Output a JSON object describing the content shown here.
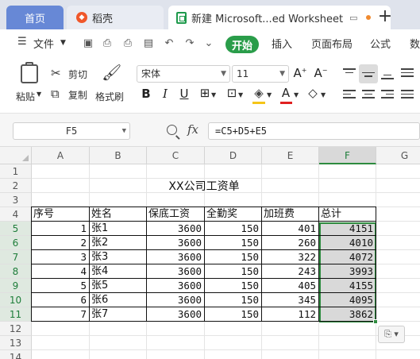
{
  "tabs": {
    "home": "首页",
    "docer": "稻壳",
    "workbook": "新建 Microsoft...ed Worksheet",
    "add": "+"
  },
  "menu": {
    "file": "文件",
    "start": "开始",
    "insert": "插入",
    "layout": "页面布局",
    "formula": "公式",
    "data": "数"
  },
  "ribbon": {
    "paste": "粘贴",
    "cut": "剪切",
    "copy": "复制",
    "format_painter": "格式刷",
    "font_name": "宋体",
    "font_size": "11",
    "bold": "B",
    "italic": "I",
    "underline": "U"
  },
  "formula_bar": {
    "cell_ref": "F5",
    "fx": "fx",
    "formula": "=C5+D5+E5"
  },
  "sheet": {
    "columns": [
      "A",
      "B",
      "C",
      "D",
      "E",
      "F",
      "G"
    ],
    "selected_column": "F",
    "rows": [
      "1",
      "2",
      "3",
      "4",
      "5",
      "6",
      "7",
      "8",
      "9",
      "10",
      "11",
      "12",
      "13",
      "14"
    ],
    "title": "XX公司工资单",
    "headers": [
      "序号",
      "姓名",
      "保底工资",
      "全勤奖",
      "加班费",
      "总计"
    ],
    "data": [
      [
        "1",
        "张1",
        "3600",
        "150",
        "401",
        "4151"
      ],
      [
        "2",
        "张2",
        "3600",
        "150",
        "260",
        "4010"
      ],
      [
        "3",
        "张3",
        "3600",
        "150",
        "322",
        "4072"
      ],
      [
        "4",
        "张4",
        "3600",
        "150",
        "243",
        "3993"
      ],
      [
        "5",
        "张5",
        "3600",
        "150",
        "405",
        "4155"
      ],
      [
        "6",
        "张6",
        "3600",
        "150",
        "345",
        "4095"
      ],
      [
        "7",
        "张7",
        "3600",
        "150",
        "112",
        "3862"
      ]
    ]
  },
  "colors": {
    "accent_green": "#2a9d4a",
    "tab_blue": "#6788d6",
    "selection_border": "#2e8b3f"
  }
}
